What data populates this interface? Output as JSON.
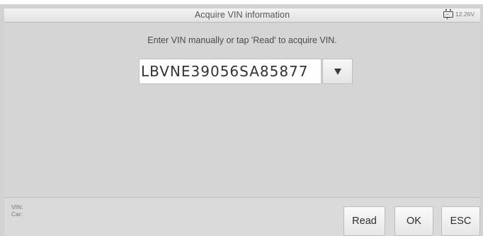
{
  "titlebar": {
    "title": "Acquire VIN information",
    "voltage": "12.26V",
    "battery_icon": "battery-icon"
  },
  "main": {
    "prompt": "Enter VIN manually or tap 'Read' to acquire VIN.",
    "vin_value": "LBVNE39056SA85877",
    "dropdown_icon": "caret-down-icon"
  },
  "info": {
    "vin_label": "VIN:",
    "car_label": "Car:"
  },
  "buttons": {
    "read": "Read",
    "ok": "OK",
    "esc": "ESC"
  },
  "colors": {
    "background": "#d5d5d5",
    "titlebar": "#ececec",
    "button": "#f0f0f0"
  }
}
